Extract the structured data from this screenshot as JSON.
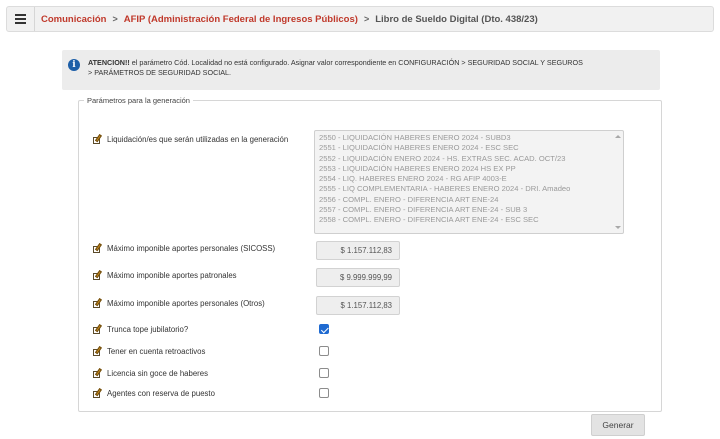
{
  "breadcrumb": {
    "items": [
      "Comunicación",
      "AFIP (Administración Federal de Ingresos Públicos)",
      "Libro de Sueldo Digital (Dto. 438/23)"
    ],
    "separator": ">"
  },
  "alert": {
    "strong": "ATENCION!!",
    "line1": " el parámetro Cód. Localidad no está configurado. Asignar valor correspondiente en CONFIGURACIÓN > SEGURIDAD SOCIAL Y SEGUROS",
    "line2": "> PARÁMETROS DE SEGURIDAD SOCIAL."
  },
  "params": {
    "legend": "Parámetros para la generación",
    "liquidaciones_label": "Liquidación/es que serán utilizadas en la generación",
    "liquidaciones_options": [
      "2550 - LIQUIDACIÓN HABERES ENERO 2024 - SUBD3",
      "2551 - LIQUIDACIÓN HABERES ENERO 2024 - ESC SEC",
      "2552 - LIQUIDACIÓN ENERO 2024 - HS. EXTRAS SEC. ACAD. OCT/23",
      "2553 - LIQUIDACIÓN HABERES ENERO 2024 HS EX PP",
      "2554 - LIQ. HABERES ENERO 2024 - RG AFIP 4003-E",
      "2555 - LIQ COMPLEMENTARIA - HABERES ENERO 2024 - DRI. Amadeo",
      "2556 - COMPL. ENERO - DIFERENCIA ART ENE-24",
      "2557 - COMPL. ENERO - DIFERENCIA ART ENE-24 - SUB 3",
      "2558 - COMPL. ENERO - DIFERENCIA ART ENE-24 - ESC SEC"
    ],
    "sicoss_label": "Máximo imponible aportes personales (SICOSS)",
    "sicoss_value": "$ 1.157.112,83",
    "patronales_label": "Máximo imponible aportes patronales",
    "patronales_value": "$ 9.999.999,99",
    "otros_label": "Máximo imponible aportes personales (Otros)",
    "otros_value": "$ 1.157.112,83",
    "checks": [
      {
        "label": "Trunca tope jubilatorio?",
        "checked": true
      },
      {
        "label": "Tener en cuenta retroactivos",
        "checked": false
      },
      {
        "label": "Licencia sin goce de haberes",
        "checked": false
      },
      {
        "label": "Agentes con reserva de puesto",
        "checked": false
      }
    ]
  },
  "actions": {
    "generate": "Generar"
  },
  "colors": {
    "link": "#c0392b",
    "info": "#1d5fa8",
    "checkbox": "#1f6ad1"
  }
}
